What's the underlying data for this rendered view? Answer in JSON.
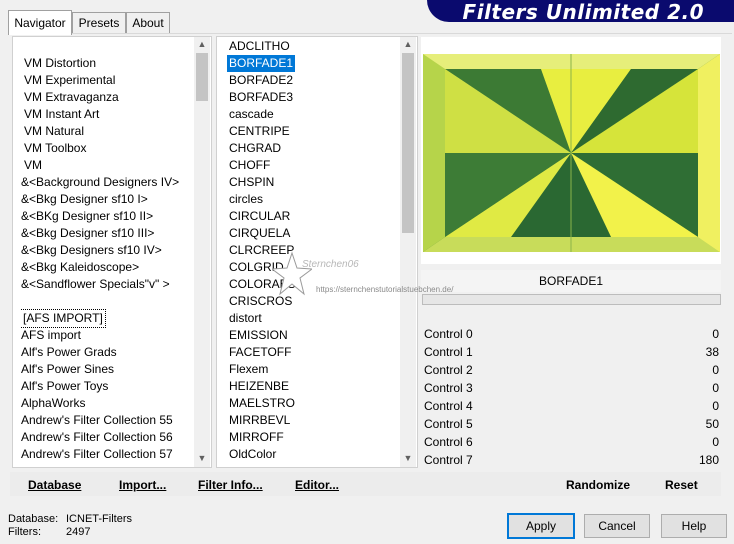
{
  "header": {
    "title": "Filters Unlimited 2.0"
  },
  "tabs": [
    "Navigator",
    "Presets",
    "About"
  ],
  "categories": [
    "VM Distortion",
    "VM Experimental",
    "VM Extravaganza",
    "VM Instant Art",
    "VM Natural",
    "VM Toolbox",
    "VM",
    "&<Background Designers IV>",
    "&<Bkg Designer sf10 I>",
    "&<BKg Designer sf10 II>",
    "&<Bkg Designer sf10 III>",
    "&<Bkg Designers sf10 IV>",
    "&<Bkg Kaleidoscope>",
    "&<Sandflower Specials\"v\" >",
    "",
    "[AFS IMPORT]",
    "AFS import",
    "Alf's Power Grads",
    "Alf's Power Sines",
    "Alf's Power Toys",
    "AlphaWorks",
    "Andrew's Filter Collection 55",
    "Andrew's Filter Collection 56",
    "Andrew's Filter Collection 57"
  ],
  "filters": [
    "ADCLITHO",
    "BORFADE1",
    "BORFADE2",
    "BORFADE3",
    "cascade",
    "CENTRIPE",
    "CHGRAD",
    "CHOFF",
    "CHSPIN",
    "circles",
    "CIRCULAR",
    "CIRQUELA",
    "CLRCREEP",
    "COLGRID",
    "COLORABS",
    "CRISCROS",
    "distort",
    "EMISSION",
    "FACETOFF",
    "Flexem",
    "HEIZENBE",
    "MAELSTRO",
    "MIRRBEVL",
    "MIRROFF",
    "OldColor"
  ],
  "selected_filter": "BORFADE1",
  "watermark": {
    "name": "Sternchen06",
    "url": "https://sternchenstutorialstuebchen.de/"
  },
  "filter_name": "BORFADE1",
  "controls": [
    {
      "label": "Control 0",
      "value": "0"
    },
    {
      "label": "Control 1",
      "value": "38"
    },
    {
      "label": "Control 2",
      "value": "0"
    },
    {
      "label": "Control 3",
      "value": "0"
    },
    {
      "label": "Control 4",
      "value": "0"
    },
    {
      "label": "Control 5",
      "value": "50"
    },
    {
      "label": "Control 6",
      "value": "0"
    },
    {
      "label": "Control 7",
      "value": "180"
    }
  ],
  "toolbar": {
    "database": "Database",
    "import": "Import...",
    "filter_info": "Filter Info...",
    "editor": "Editor...",
    "randomize": "Randomize",
    "reset": "Reset"
  },
  "status": {
    "database_label": "Database:",
    "database_value": "ICNET-Filters",
    "filters_label": "Filters:",
    "filters_value": "2497"
  },
  "buttons": {
    "apply": "Apply",
    "cancel": "Cancel",
    "help": "Help"
  },
  "colors": {
    "header_bg": "#0a0a6e",
    "selection": "#0078d7",
    "preview_yellow": "#f0f020",
    "preview_green": "#2a6e2a"
  }
}
